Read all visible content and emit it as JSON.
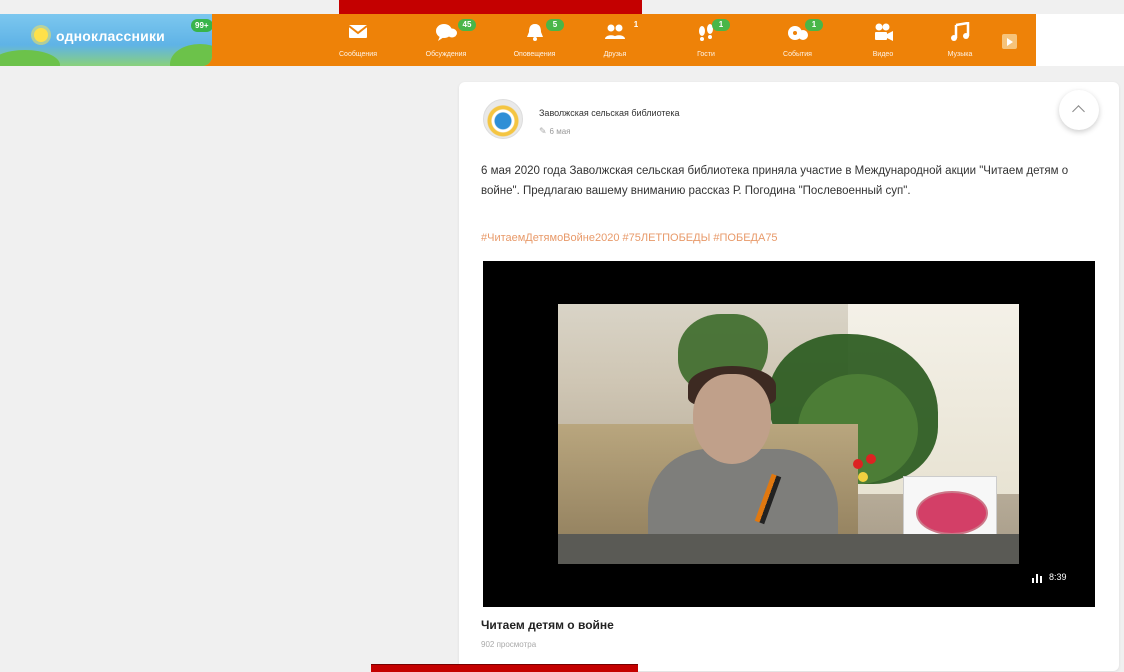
{
  "brand": {
    "logo_text": "одноклассники",
    "badge": "99+"
  },
  "nav": [
    {
      "id": "messages",
      "label": "Сообщения",
      "icon": "envelope-icon",
      "badge": ""
    },
    {
      "id": "discussions",
      "label": "Обсуждения",
      "icon": "chat-bubbles-icon",
      "badge": "45"
    },
    {
      "id": "notifications",
      "label": "Оповещения",
      "icon": "bell-icon",
      "badge": "5"
    },
    {
      "id": "friends",
      "label": "Друзья",
      "icon": "friends-icon",
      "badge": "1"
    },
    {
      "id": "guests",
      "label": "Гости",
      "icon": "footprints-icon",
      "badge": "1"
    },
    {
      "id": "events",
      "label": "События",
      "icon": "events-icon",
      "badge": "1"
    },
    {
      "id": "video",
      "label": "Видео",
      "icon": "video-camera-icon",
      "badge": ""
    },
    {
      "id": "music",
      "label": "Музыка",
      "icon": "music-note-icon",
      "badge": ""
    }
  ],
  "post": {
    "author": "Заволжская сельская библиотека",
    "date": "6 мая",
    "text": "6 мая 2020 года Заволжская сельская библиотека приняла участие в Международной акции \"Читаем детям о войне\". Предлагаю вашему вниманию рассказ Р. Погодина \"Послевоенный суп\".",
    "hashtags": "#ЧитаемДетямоВойне2020 #75ЛЕТПОБЕДЫ #ПОБЕДА75",
    "video": {
      "duration": "8:39",
      "title": "Читаем детям о войне",
      "views": "902 просмотра"
    }
  }
}
